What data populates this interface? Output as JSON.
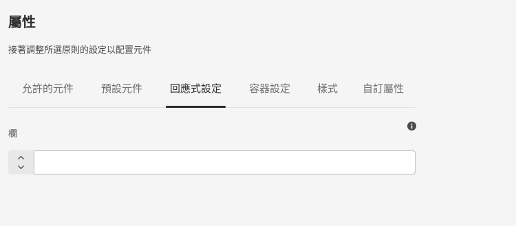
{
  "header": {
    "title": "屬性",
    "subtitle": "接著調整所選原則的設定以配置元件"
  },
  "tabs": [
    {
      "label": "允許的元件",
      "selected": false
    },
    {
      "label": "預設元件",
      "selected": false
    },
    {
      "label": "回應式設定",
      "selected": true
    },
    {
      "label": "容器設定",
      "selected": false
    },
    {
      "label": "樣式",
      "selected": false
    },
    {
      "label": "自訂屬性",
      "selected": false
    }
  ],
  "field": {
    "label": "欄",
    "value": "",
    "info_icon": "info-icon",
    "stepper_up_icon": "chevron-up-icon",
    "stepper_down_icon": "chevron-down-icon"
  },
  "colors": {
    "background": "#f5f5f5",
    "text": "#2c2c2c",
    "muted_text": "#6e6e6e",
    "selected_tab_indicator": "#2c2c2c",
    "input_border": "#bdbdbd"
  }
}
